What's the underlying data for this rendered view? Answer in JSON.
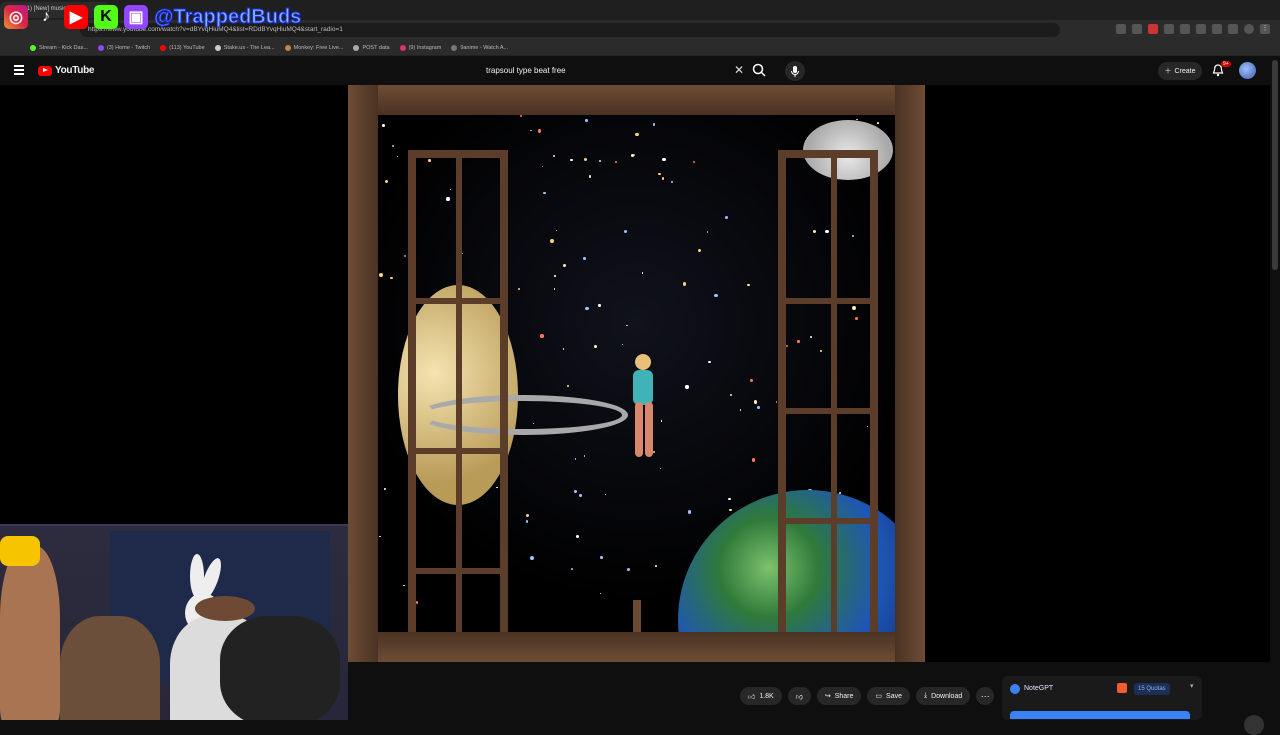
{
  "browser": {
    "tab_title": "(161) [New] music",
    "url": "https://www.youtube.com/watch?v=dBYvqHiuMQ4&list=RDdBYvqHiuMQ4&start_radio=1",
    "bookmarks": [
      {
        "label": "Stream - Kick Das...",
        "color": "#53fc18"
      },
      {
        "label": "(3) Home - Twitch",
        "color": "#9146ff"
      },
      {
        "label": "(113) YouTube",
        "color": "#ff0000"
      },
      {
        "label": "Stake.us - The Lea...",
        "color": "#cccccc"
      },
      {
        "label": "Monkey: Free Live...",
        "color": "#c08a3e"
      },
      {
        "label": "POST data",
        "color": "#aaaaaa"
      },
      {
        "label": "(9) Instagram",
        "color": "#e1306c"
      },
      {
        "label": "9anime - Watch A...",
        "color": "#777777"
      }
    ]
  },
  "overlay": {
    "handle": "@TrappedBuds"
  },
  "youtube": {
    "logo_text": "YouTube",
    "search_value": "trapsoul type beat free",
    "create_label": "Create",
    "notif_badge": "9+"
  },
  "actions": {
    "like_count": "1.8K",
    "share_label": "Share",
    "save_label": "Save",
    "download_label": "Download"
  },
  "notegpt": {
    "title": "NoteGPT",
    "quota": "15 Quotas"
  }
}
